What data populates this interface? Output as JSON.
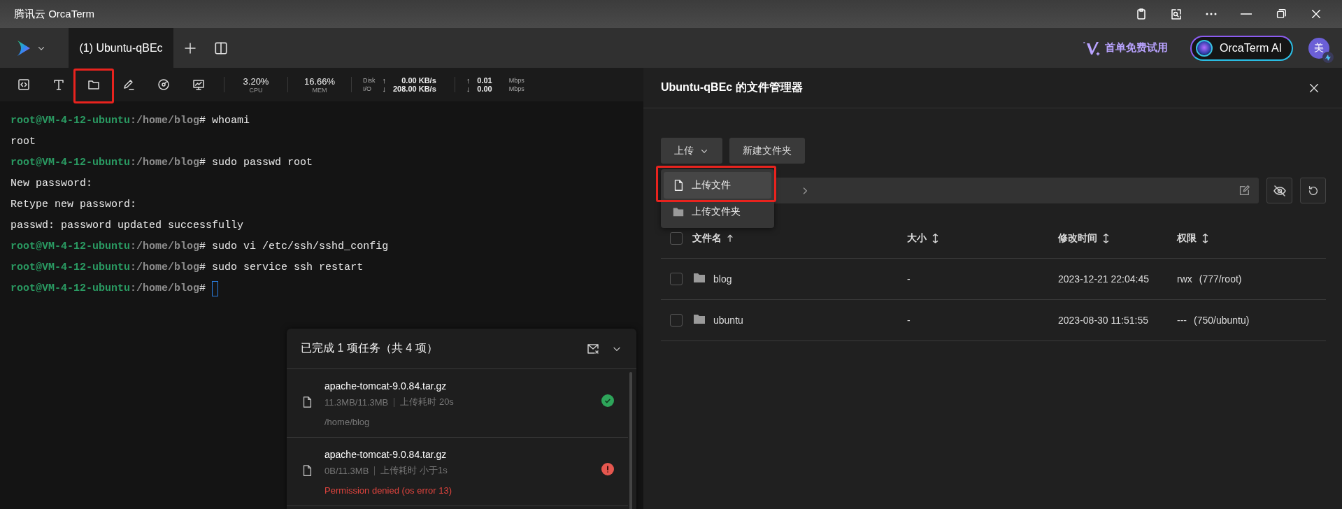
{
  "window": {
    "title": "腾讯云 OrcaTerm"
  },
  "tabs": [
    {
      "label": "(1) Ubuntu-qBEc",
      "selected": true
    }
  ],
  "header": {
    "promo": "首单免费试用",
    "ai_button": "OrcaTerm AI",
    "avatar": "美"
  },
  "toolbar": {
    "tools": [
      {
        "kind": "code",
        "highlighted": false
      },
      {
        "kind": "text",
        "highlighted": false
      },
      {
        "kind": "folder",
        "highlighted": true
      },
      {
        "kind": "pen",
        "highlighted": false
      },
      {
        "kind": "gauge",
        "highlighted": false
      },
      {
        "kind": "monitor",
        "highlighted": false
      }
    ],
    "stats": [
      {
        "value": "3.20%",
        "label": "CPU"
      },
      {
        "value": "16.66%",
        "label": "MEM"
      }
    ],
    "io": [
      {
        "label": "Disk",
        "arrow": "↑",
        "value": "0.00 KB/s"
      },
      {
        "label": "I/O",
        "arrow": "↓",
        "value": "208.00 KB/s"
      }
    ],
    "net": [
      {
        "arrow": "↑",
        "value": "0.01",
        "unit": "Mbps"
      },
      {
        "arrow": "↓",
        "value": "0.00",
        "unit": "Mbps"
      }
    ]
  },
  "terminal": {
    "lines": [
      {
        "kind": "command",
        "user": "root@VM-4-12-ubuntu",
        "path": ":/home/blog",
        "symbol": "#",
        "command": "whoami"
      },
      {
        "kind": "output",
        "text": "root"
      },
      {
        "kind": "command",
        "user": "root@VM-4-12-ubuntu",
        "path": ":/home/blog",
        "symbol": "#",
        "command": "sudo passwd root"
      },
      {
        "kind": "output",
        "text": "New password:"
      },
      {
        "kind": "output",
        "text": "Retype new password:"
      },
      {
        "kind": "output",
        "text": "passwd: password updated successfully"
      },
      {
        "kind": "command",
        "user": "root@VM-4-12-ubuntu",
        "path": ":/home/blog",
        "symbol": "#",
        "command": "sudo vi /etc/ssh/sshd_config"
      },
      {
        "kind": "command",
        "user": "root@VM-4-12-ubuntu",
        "path": ":/home/blog",
        "symbol": "#",
        "command": "sudo service ssh restart"
      },
      {
        "kind": "command",
        "user": "root@VM-4-12-ubuntu",
        "path": ":/home/blog",
        "symbol": "#",
        "cursor": true
      }
    ]
  },
  "task_panel": {
    "title": "已完成 1 项任务（共 4 项）",
    "items": [
      {
        "failed": false,
        "name": "apache-tomcat-9.0.84.tar.gz",
        "size": "11.3MB/11.3MB",
        "duration": "上传耗时 20s",
        "detail": "/home/blog"
      },
      {
        "failed": true,
        "name": "apache-tomcat-9.0.84.tar.gz",
        "size": "0B/11.3MB",
        "duration": "上传耗时 小于1s",
        "detail": "Permission denied (os error 13)"
      }
    ]
  },
  "file_manager": {
    "title": "Ubuntu-qBEc 的文件管理器",
    "upload_button": "上传",
    "new_folder_button": "新建文件夹",
    "upload_menu": [
      {
        "kind": "file",
        "label": "上传文件",
        "highlighted": true
      },
      {
        "kind": "folder",
        "label": "上传文件夹",
        "highlighted": false
      }
    ],
    "table": {
      "all_checked": false,
      "columns": [
        {
          "label": "文件名",
          "sorted": true
        },
        {
          "label": "大小",
          "sorted": false
        },
        {
          "label": "修改时间",
          "sorted": false
        },
        {
          "label": "权限",
          "sorted": false
        }
      ],
      "rows": [
        {
          "kind": "folder",
          "checked": false,
          "name": "blog",
          "size": "-",
          "modified": "2023-12-21 22:04:45",
          "mode": "rwx",
          "owner": "(777/root)"
        },
        {
          "kind": "folder",
          "checked": false,
          "name": "ubuntu",
          "size": "-",
          "modified": "2023-08-30 11:51:55",
          "mode": "---",
          "owner": "(750/ubuntu)"
        }
      ]
    }
  }
}
